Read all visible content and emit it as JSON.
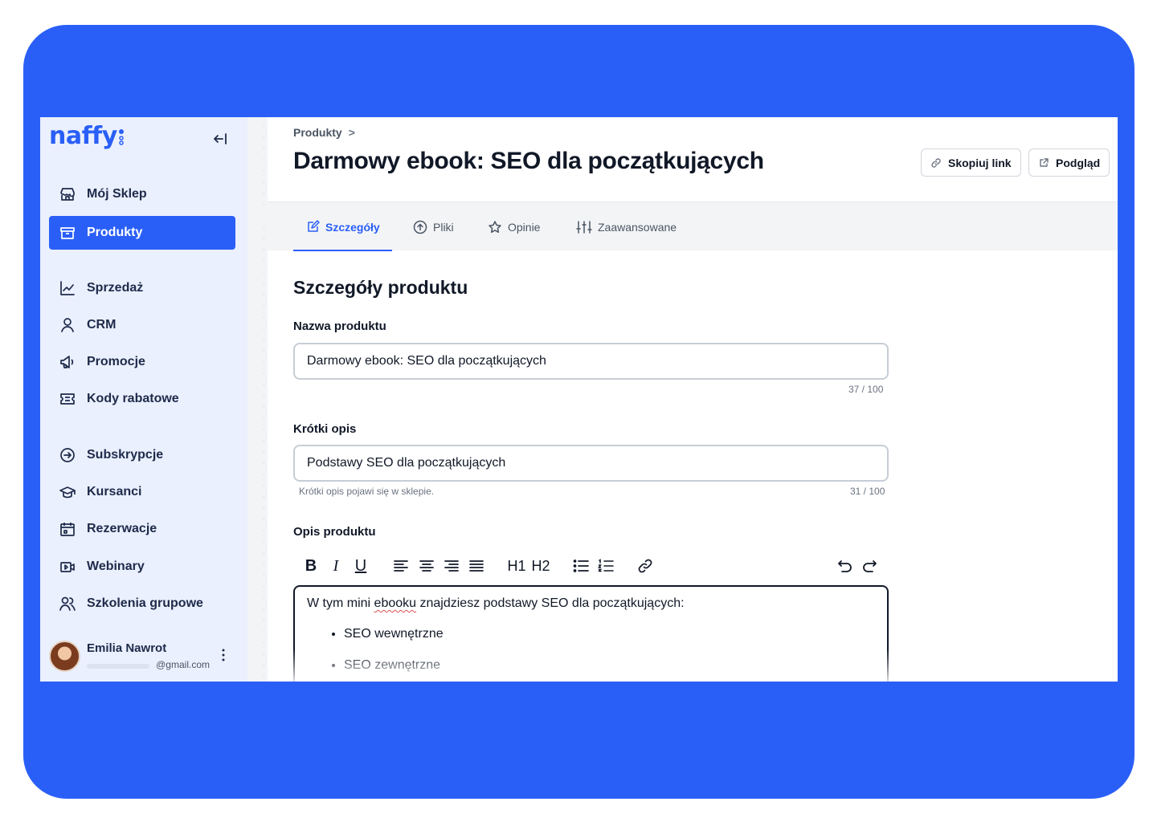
{
  "brand": {
    "logo_text": "naffy",
    "accent": "#2a5ff7",
    "frame_color": "#2a5ff7"
  },
  "sidebar": {
    "items": [
      {
        "label": "Mój Sklep",
        "icon": "store-icon",
        "active": false
      },
      {
        "label": "Produkty",
        "icon": "box-icon",
        "active": true
      },
      {
        "label": "Sprzedaż",
        "icon": "chart-line-icon",
        "active": false
      },
      {
        "label": "CRM",
        "icon": "user-icon",
        "active": false
      },
      {
        "label": "Promocje",
        "icon": "megaphone-icon",
        "active": false
      },
      {
        "label": "Kody rabatowe",
        "icon": "ticket-icon",
        "active": false
      },
      {
        "label": "Subskrypcje",
        "icon": "subscription-icon",
        "active": false
      },
      {
        "label": "Kursanci",
        "icon": "graduation-cap-icon",
        "active": false
      },
      {
        "label": "Rezerwacje",
        "icon": "calendar-icon",
        "active": false
      },
      {
        "label": "Webinary",
        "icon": "video-icon",
        "active": false
      },
      {
        "label": "Szkolenia grupowe",
        "icon": "users-icon",
        "active": false
      }
    ],
    "user": {
      "name": "Emilia Nawrot",
      "email": "@gmail.com"
    }
  },
  "header": {
    "breadcrumb": [
      "Produkty",
      ">"
    ],
    "title": "Darmowy ebook: SEO dla początkujących",
    "copy_link_label": "Skopiuj link",
    "preview_label": "Podgląd"
  },
  "tabs": [
    {
      "label": "Szczegóły",
      "icon": "edit-icon",
      "active": true
    },
    {
      "label": "Pliki",
      "icon": "upload-icon",
      "active": false
    },
    {
      "label": "Opinie",
      "icon": "star-icon",
      "active": false
    },
    {
      "label": "Zaawansowane",
      "icon": "sliders-icon",
      "active": false
    }
  ],
  "form": {
    "section_title": "Szczegóły produktu",
    "name": {
      "label": "Nazwa produktu",
      "value": "Darmowy ebook: SEO dla początkujących",
      "counter": "37 / 100"
    },
    "short_desc": {
      "label": "Krótki opis",
      "value": "Podstawy SEO dla początkujących",
      "hint": "Krótki opis pojawi się w sklepie.",
      "counter": "31 / 100"
    },
    "description": {
      "label": "Opis produktu",
      "intro_before": "W tym mini ",
      "intro_misspelled": "ebooku",
      "intro_after": " znajdziesz podstawy SEO dla początkujących:",
      "bullets": [
        "SEO wewnętrzne",
        "SEO zewnętrzne"
      ]
    },
    "toolbar": {
      "bold": "B",
      "italic": "I",
      "underline": "U",
      "h1": "H1",
      "h2": "H2"
    }
  }
}
